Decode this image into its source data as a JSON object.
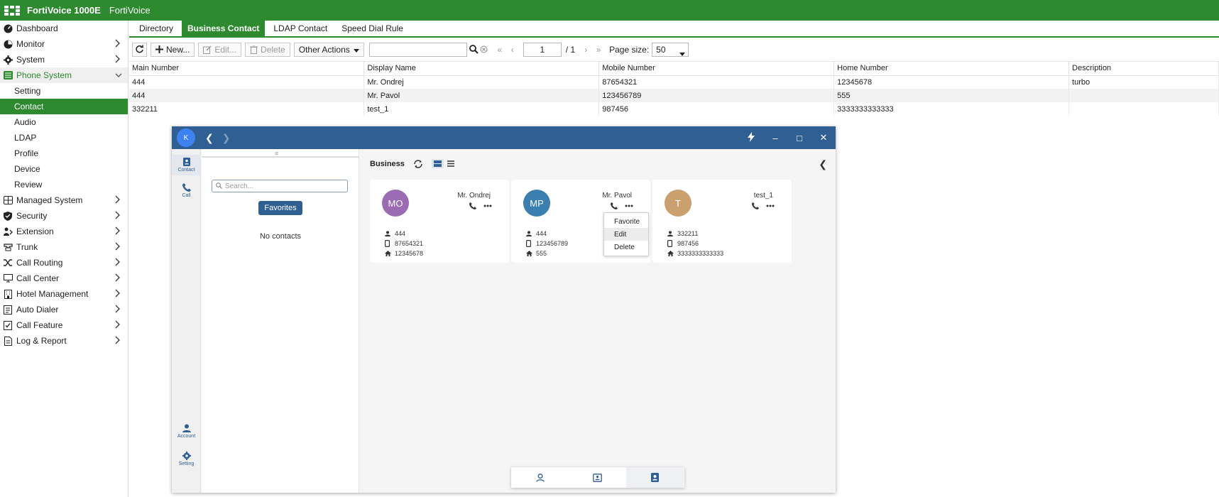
{
  "app": {
    "product": "FortiVoice 1000E",
    "brand": "FortiVoice"
  },
  "sidebar": {
    "items": [
      {
        "label": "Dashboard",
        "icon": "dashboard-icon",
        "chev": false,
        "kind": "top"
      },
      {
        "label": "Monitor",
        "icon": "monitor-icon",
        "chev": true,
        "kind": "top"
      },
      {
        "label": "System",
        "icon": "gear-icon",
        "chev": true,
        "kind": "top"
      },
      {
        "label": "Phone System",
        "icon": "phone-system-icon",
        "chev": true,
        "kind": "expanded"
      },
      {
        "label": "Setting",
        "kind": "sub"
      },
      {
        "label": "Contact",
        "kind": "selected"
      },
      {
        "label": "Audio",
        "kind": "sub"
      },
      {
        "label": "LDAP",
        "kind": "sub"
      },
      {
        "label": "Profile",
        "kind": "sub"
      },
      {
        "label": "Device",
        "kind": "sub"
      },
      {
        "label": "Review",
        "kind": "sub"
      },
      {
        "label": "Managed System",
        "icon": "managed-system-icon",
        "chev": true,
        "kind": "top"
      },
      {
        "label": "Security",
        "icon": "shield-icon",
        "chev": true,
        "kind": "top"
      },
      {
        "label": "Extension",
        "icon": "extension-icon",
        "chev": true,
        "kind": "top"
      },
      {
        "label": "Trunk",
        "icon": "trunk-icon",
        "chev": true,
        "kind": "top"
      },
      {
        "label": "Call Routing",
        "icon": "shuffle-icon",
        "chev": true,
        "kind": "top"
      },
      {
        "label": "Call Center",
        "icon": "call-center-icon",
        "chev": true,
        "kind": "top"
      },
      {
        "label": "Hotel Management",
        "icon": "hotel-icon",
        "chev": true,
        "kind": "top"
      },
      {
        "label": "Auto Dialer",
        "icon": "auto-dialer-icon",
        "chev": true,
        "kind": "top"
      },
      {
        "label": "Call Feature",
        "icon": "call-feature-icon",
        "chev": true,
        "kind": "top"
      },
      {
        "label": "Log & Report",
        "icon": "log-report-icon",
        "chev": true,
        "kind": "top"
      }
    ]
  },
  "tabs": [
    "Directory",
    "Business Contact",
    "LDAP Contact",
    "Speed Dial Rule"
  ],
  "active_tab": "Business Contact",
  "toolbar": {
    "new_label": "New...",
    "edit_label": "Edit...",
    "delete_label": "Delete",
    "other_actions_label": "Other Actions",
    "search_value": "",
    "page_current": "1",
    "page_total": "/ 1",
    "page_size_label": "Page size:",
    "page_size_value": "50"
  },
  "table": {
    "columns": [
      "Main Number",
      "Display Name",
      "Mobile Number",
      "Home Number",
      "Description"
    ],
    "rows": [
      [
        "444",
        "Mr. Ondrej",
        "87654321",
        "12345678",
        "turbo"
      ],
      [
        "444",
        "Mr. Pavol",
        "123456789",
        "555",
        ""
      ],
      [
        "332211",
        "test_1",
        "987456",
        "3333333333333",
        ""
      ]
    ]
  },
  "window": {
    "avatar_letter": "K",
    "rail": {
      "contact_label": "Contact",
      "call_label": "Call",
      "account_label": "Account",
      "setting_label": "Setting"
    },
    "search_placeholder": "Search...",
    "favorites_label": "Favorites",
    "no_contacts": "No contacts",
    "section_title": "Business",
    "cards": [
      {
        "initials": "MO",
        "name": "Mr. Ondrej",
        "color": "#9b6bb3",
        "main": "444",
        "mobile": "87654321",
        "home": "12345678"
      },
      {
        "initials": "MP",
        "name": "Mr. Pavol",
        "color": "#3a7fb0",
        "main": "444",
        "mobile": "123456789",
        "home": "555"
      },
      {
        "initials": "T",
        "name": "test_1",
        "color": "#c9a06e",
        "main": "332211",
        "mobile": "987456",
        "home": "3333333333333"
      }
    ],
    "menu": [
      "Favorite",
      "Edit",
      "Delete"
    ]
  },
  "colors": {
    "fortinet_green": "#2d8a2e",
    "window_blue": "#2f5f93"
  }
}
